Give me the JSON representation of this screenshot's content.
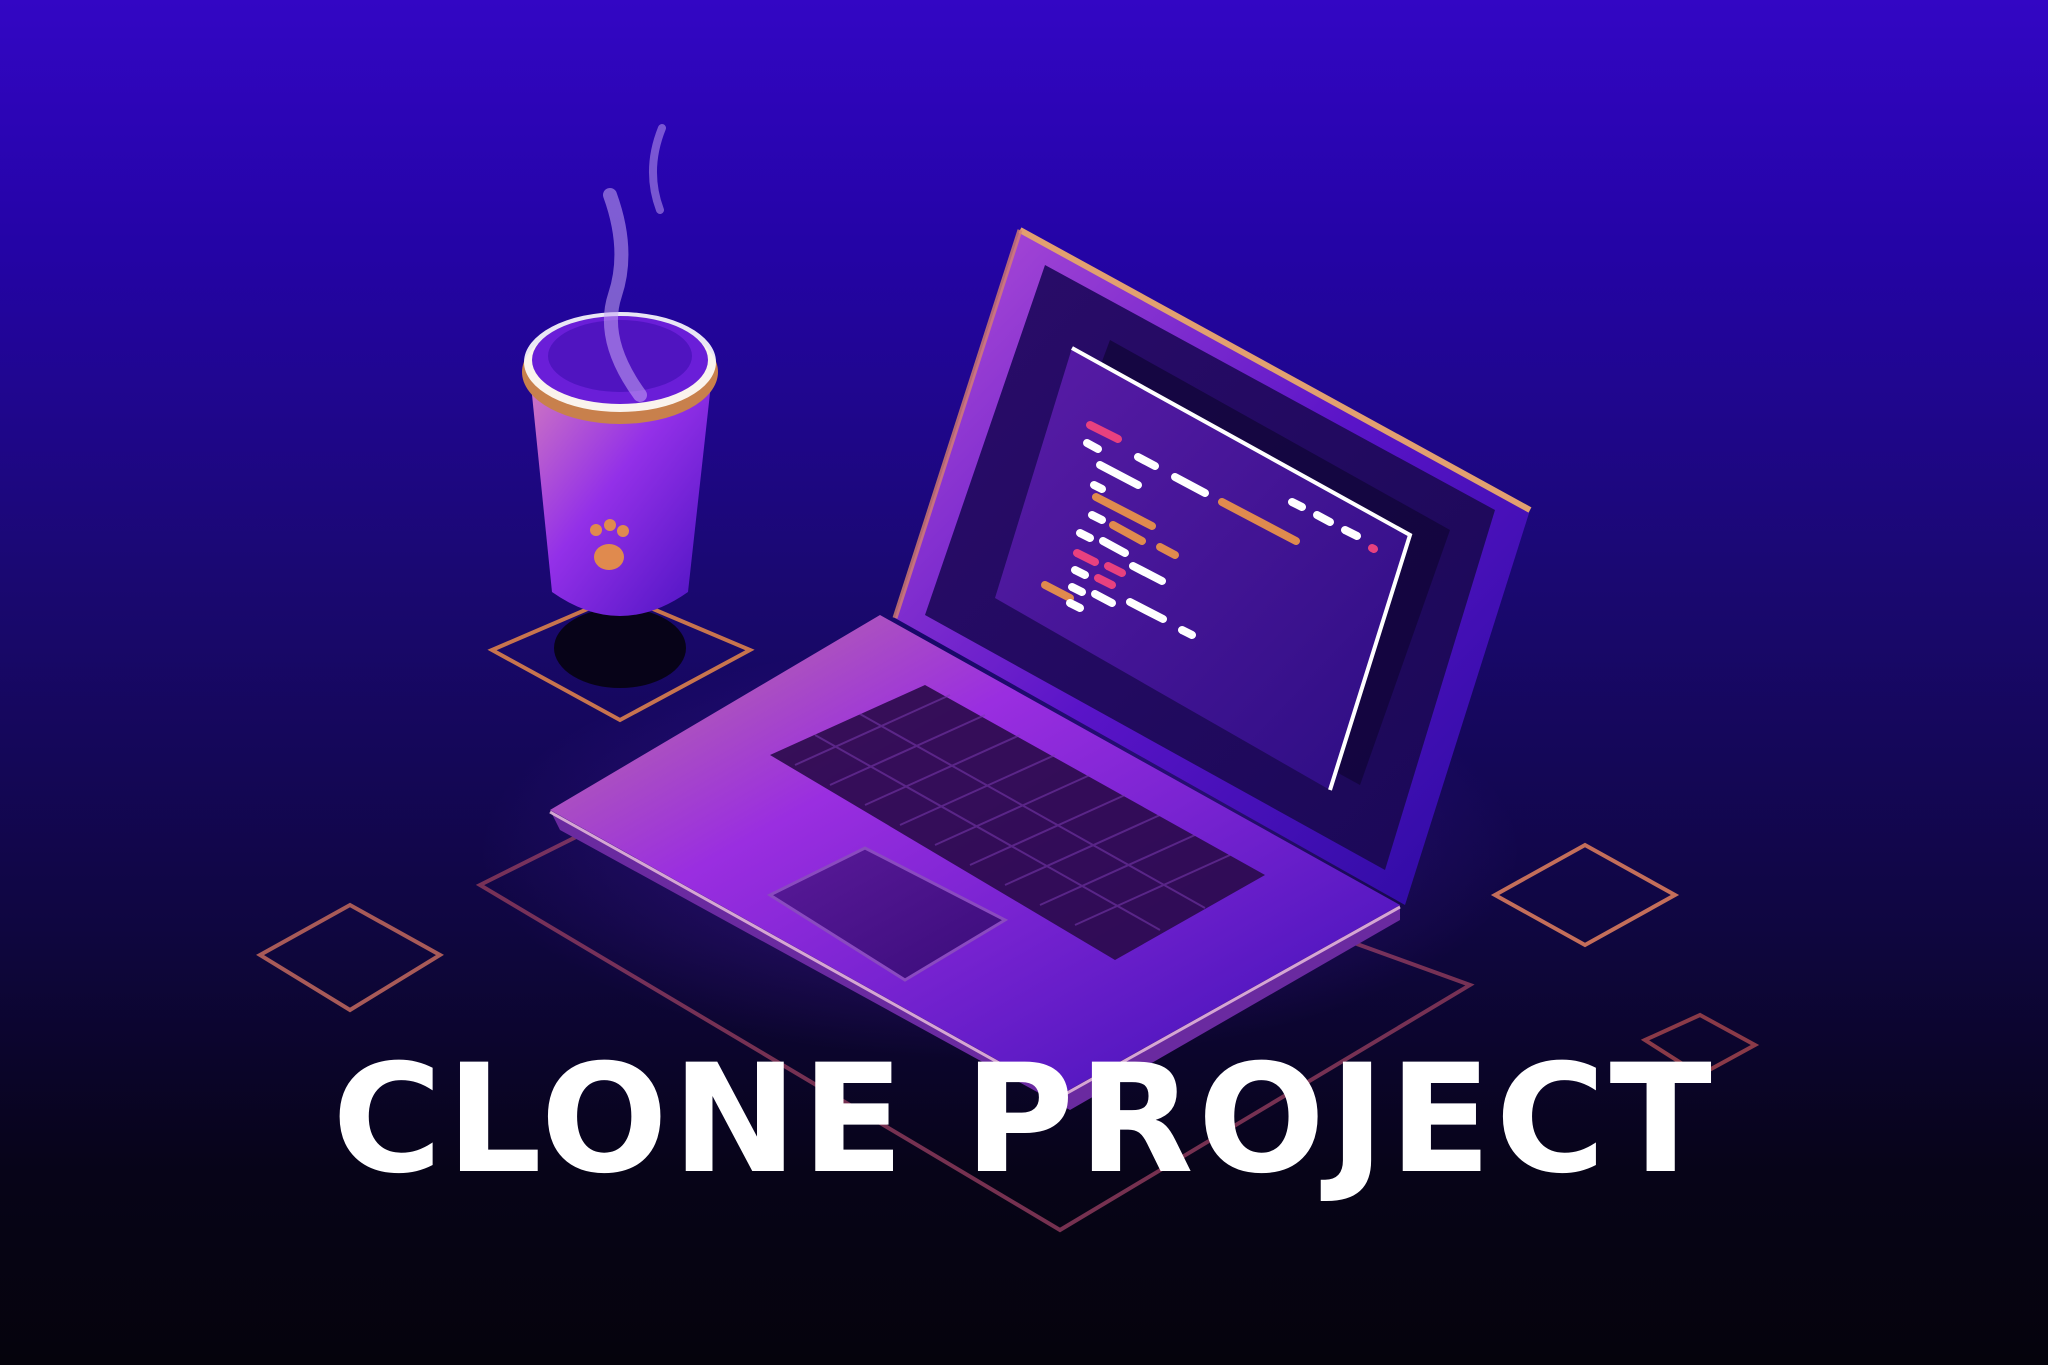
{
  "headline": {
    "text": "CLONE PROJECT"
  },
  "colors": {
    "background_top": "#3306c4",
    "background_bottom": "#05030c",
    "accent_orange": "#e08a4e",
    "accent_pink": "#e8417f",
    "accent_purple": "#8a2be2",
    "headline": "#ffffff"
  },
  "icons": {
    "laptop": "laptop-icon",
    "coffee_cup": "coffee-cup-icon",
    "paw": "paw-icon",
    "steam": "steam-icon"
  }
}
